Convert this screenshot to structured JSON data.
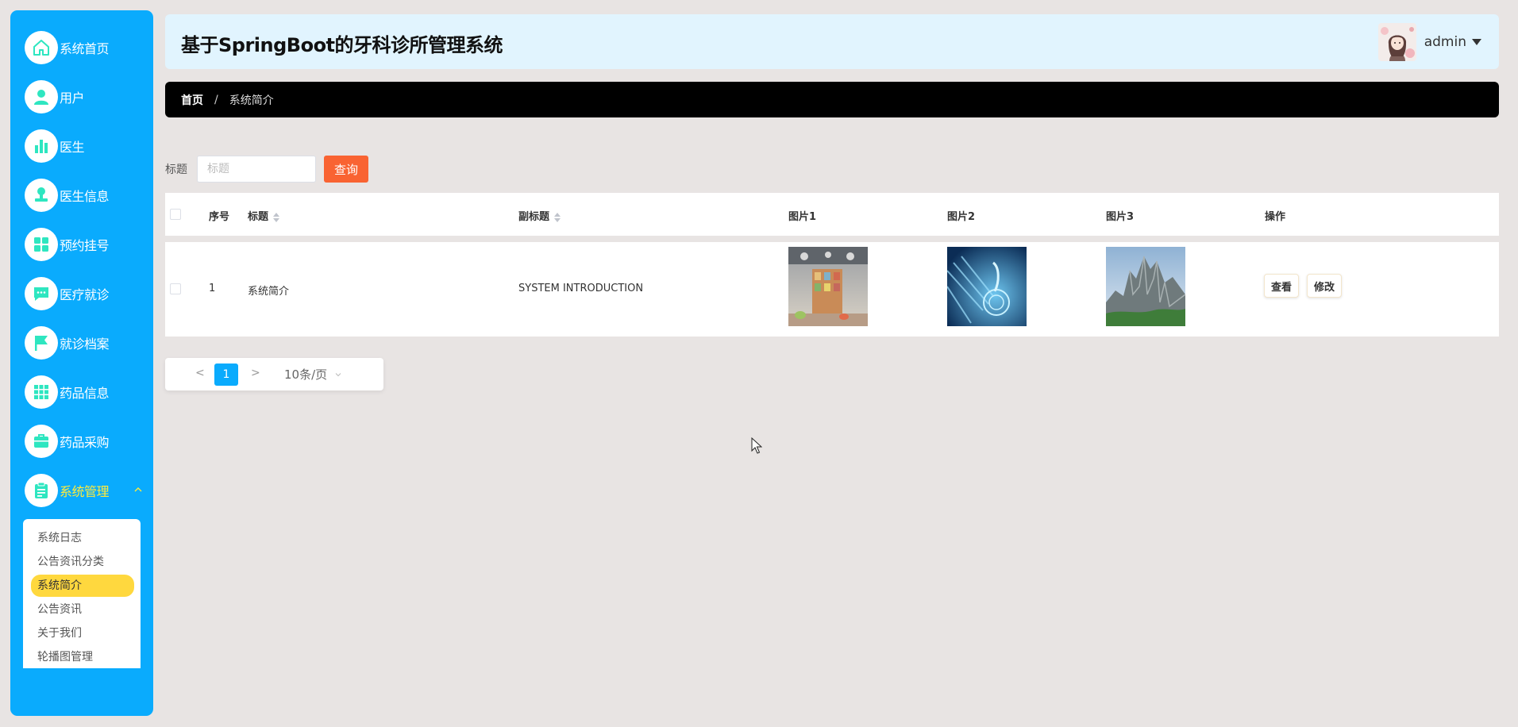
{
  "sidebar": {
    "items": [
      {
        "label": "系统首页",
        "icon": "home-icon"
      },
      {
        "label": "用户",
        "icon": "user-icon"
      },
      {
        "label": "医生",
        "icon": "bar-chart-icon"
      },
      {
        "label": "医生信息",
        "icon": "stamp-icon"
      },
      {
        "label": "预约挂号",
        "icon": "grid-icon"
      },
      {
        "label": "医疗就诊",
        "icon": "chat-icon"
      },
      {
        "label": "就诊档案",
        "icon": "flag-icon"
      },
      {
        "label": "药品信息",
        "icon": "apps-icon"
      },
      {
        "label": "药品采购",
        "icon": "briefcase-icon"
      },
      {
        "label": "系统管理",
        "icon": "clipboard-icon"
      }
    ],
    "submenu": [
      "系统日志",
      "公告资讯分类",
      "系统简介",
      "公告资讯",
      "关于我们",
      "轮播图管理"
    ],
    "active_submenu": "系统简介"
  },
  "header": {
    "title": "基于SpringBoot的牙科诊所管理系统",
    "username": "admin"
  },
  "breadcrumb": {
    "home": "首页",
    "separator": "/",
    "current": "系统简介"
  },
  "search": {
    "label": "标题",
    "placeholder": "标题",
    "button": "查询"
  },
  "table": {
    "headers": {
      "index": "序号",
      "title": "标题",
      "subtitle": "副标题",
      "image1": "图片1",
      "image2": "图片2",
      "image3": "图片3",
      "actions": "操作"
    },
    "rows": [
      {
        "index": "1",
        "title": "系统简介",
        "subtitle": "SYSTEM INTRODUCTION",
        "view_label": "查看",
        "edit_label": "修改"
      }
    ]
  },
  "pagination": {
    "prev": "<",
    "page": "1",
    "next": ">",
    "page_size": "10条/页"
  },
  "colors": {
    "sidebar": "#0aabfd",
    "header_bg": "#e1f4fe",
    "breadcrumb_bg": "#000000",
    "search_button": "#f96332",
    "active_submenu": "#ffd83e",
    "icon_accent": "#2ee6c0"
  }
}
